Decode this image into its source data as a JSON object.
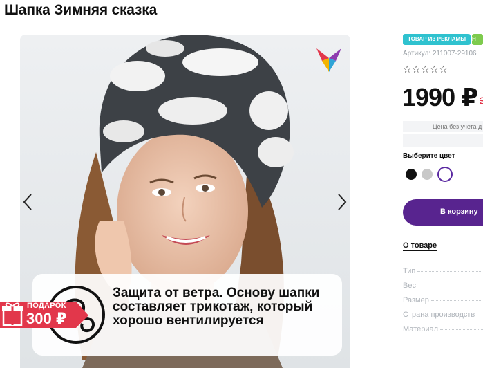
{
  "product": {
    "title": "Шапка Зимняя сказка",
    "badge_promo": "ТОВАР ИЗ РЕКЛАМЫ",
    "badge_extra": "Н",
    "sku": "Артикул: 211007-29106",
    "rating_stars": "☆☆☆☆☆",
    "price": "1990 ₽",
    "old_price": "2",
    "price_note": "Цена без учета д",
    "choose_color_label": "Выберите цвет",
    "colors": [
      "#111111",
      "#c8c8c8",
      "#ffffff"
    ],
    "selected_color_index": 2,
    "cart_button": "В корзину",
    "about_link": "О товаре",
    "attributes": [
      "Тип",
      "Вес",
      "Размер",
      "Страна производств",
      "Материал"
    ]
  },
  "gallery": {
    "info_text": "Защита от ветра. Основу шапки составляет трикотаж, который хорошо вентилируется",
    "gift_label": "ПОДАРОК",
    "gift_value": "300 ₽",
    "icons": [
      "chevron-left-icon",
      "chevron-right-icon",
      "brand-logo-icon",
      "wind-icon",
      "gift-icon"
    ],
    "accent_colors": {
      "gift": "#e2374b",
      "cart": "#58248f",
      "promo": "#2fc2cf",
      "green": "#7ecb4e"
    }
  }
}
